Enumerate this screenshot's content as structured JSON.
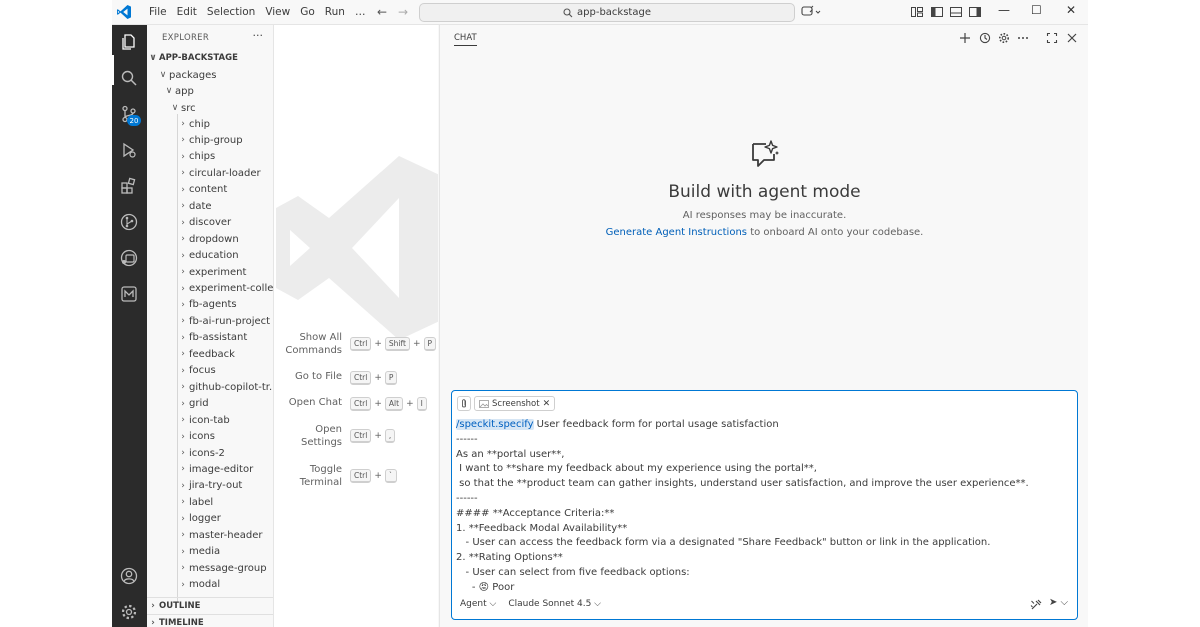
{
  "titlebar": {
    "menu": [
      "File",
      "Edit",
      "Selection",
      "View",
      "Go",
      "Run",
      "…"
    ],
    "search": "app-backstage",
    "back": "←",
    "forward": "→",
    "minimize": "—",
    "maximize": "☐",
    "close": "✕"
  },
  "activity_bar": {
    "scm_badge": "20",
    "icons": [
      "explorer-icon",
      "search-icon",
      "source-control-icon",
      "run-debug-icon",
      "extensions-icon",
      "git-graph-icon",
      "remote-explorer-icon",
      "gitlens-icon",
      "account-icon",
      "settings-gear-icon"
    ]
  },
  "explorer": {
    "header": "EXPLORER",
    "more": "···",
    "root": "APP-BACKSTAGE",
    "packages": "packages",
    "app": "app",
    "src": "src",
    "folders": [
      "chip",
      "chip-group",
      "chips",
      "circular-loader",
      "content",
      "date",
      "discover",
      "dropdown",
      "education",
      "experiment",
      "experiment-colle...",
      "fb-agents",
      "fb-ai-run-project",
      "fb-assistant",
      "feedback",
      "focus",
      "github-copilot-tr...",
      "grid",
      "icon-tab",
      "icons",
      "icons-2",
      "image-editor",
      "jira-try-out",
      "label",
      "logger",
      "master-header",
      "media",
      "message-group",
      "modal"
    ],
    "outline": "OUTLINE",
    "timeline": "TIMELINE"
  },
  "welcome": {
    "commands": [
      {
        "label": "Show All Commands",
        "keys": [
          "Ctrl",
          "Shift",
          "P"
        ]
      },
      {
        "label": "Go to File",
        "keys": [
          "Ctrl",
          "P"
        ]
      },
      {
        "label": "Open Chat",
        "keys": [
          "Ctrl",
          "Alt",
          "I"
        ]
      },
      {
        "label": "Open Settings",
        "keys": [
          "Ctrl",
          ","
        ]
      },
      {
        "label": "Toggle Terminal",
        "keys": [
          "Ctrl",
          "`"
        ]
      }
    ],
    "plus": "+"
  },
  "chat": {
    "tab": "CHAT",
    "title": "Build with agent mode",
    "disclaimer": "AI responses may be inaccurate.",
    "link": "Generate Agent Instructions",
    "link_suffix": " to onboard AI onto your codebase.",
    "attachment": "Screenshot",
    "attachment_close": "✕",
    "slash_command": "/speckit.specify",
    "first_line_rest": " User feedback form for portal usage satisfaction",
    "lines": [
      "------",
      "As an **portal user**,",
      " I want to **share my feedback about my experience using the portal**,",
      " so that the **product team can gather insights, understand user satisfaction, and improve the user experience**.",
      "------",
      "#### **Acceptance Criteria:**",
      "1. **Feedback Modal Availability**",
      "   - User can access the feedback form via a designated \"Share Feedback\" button or link in the application.",
      "2. **Rating Options**",
      "   - User can select from five feedback options:",
      "     - 😡 Poor"
    ],
    "mode": "Agent ⌵",
    "model": "Claude Sonnet 4.5 ⌵",
    "send": "➤ ⌵"
  }
}
